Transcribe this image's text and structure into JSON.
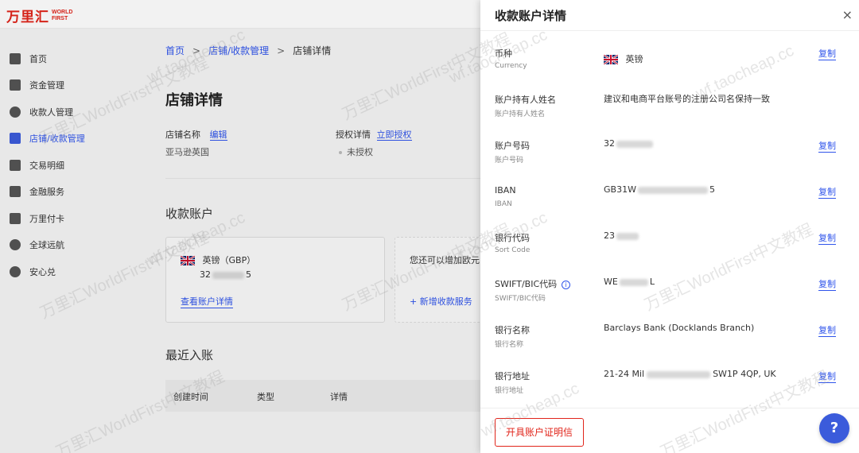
{
  "brand": {
    "cn": "万里汇",
    "en_line1": "WORLD",
    "en_line2": "FIRST"
  },
  "sidebar": {
    "items": [
      {
        "label": "首页",
        "icon": "home-icon"
      },
      {
        "label": "资金管理",
        "icon": "funds-icon"
      },
      {
        "label": "收款人管理",
        "icon": "payee-icon"
      },
      {
        "label": "店铺/收款管理",
        "icon": "store-icon",
        "active": true
      },
      {
        "label": "交易明细",
        "icon": "transactions-icon"
      },
      {
        "label": "金融服务",
        "icon": "finance-icon"
      },
      {
        "label": "万里付卡",
        "icon": "card-icon"
      },
      {
        "label": "全球远航",
        "icon": "global-icon"
      },
      {
        "label": "安心兑",
        "icon": "exchange-icon"
      }
    ]
  },
  "breadcrumb": {
    "home": "首页",
    "store": "店铺/收款管理",
    "current": "店铺详情",
    "sep": ">"
  },
  "main": {
    "title": "店铺详情",
    "store_name_label": "店铺名称",
    "store_name_edit": "编辑",
    "store_name_value": "亚马逊英国",
    "auth_label": "授权详情",
    "auth_link": "立即授权",
    "auth_value": "未授权",
    "accounts_title": "收款账户",
    "card1": {
      "currency": "英镑（GBP）",
      "account_prefix": "32",
      "account_suffix": "5",
      "link": "查看账户详情"
    },
    "card2": {
      "text": "您还可以增加欧元",
      "link": "+ 新增收款服务"
    },
    "recent_title": "最近入账",
    "table_headers": [
      "创建时间",
      "类型",
      "详情"
    ]
  },
  "drawer": {
    "title": "收款账户详情",
    "close": "×",
    "copy_label": "复制",
    "rows": [
      {
        "label": "币种",
        "sub": "Currency",
        "value": "英镑",
        "copy": true,
        "flag": true
      },
      {
        "label": "账户持有人姓名",
        "sub": "账户持有人姓名",
        "value": "建议和电商平台账号的注册公司名保持一致",
        "copy": false
      },
      {
        "label": "账户号码",
        "sub": "账户号码",
        "value": "32",
        "copy": true
      },
      {
        "label": "IBAN",
        "sub": "IBAN",
        "value": "GB31W",
        "value_suffix": "5",
        "copy": true
      },
      {
        "label": "银行代码",
        "sub": "Sort Code",
        "value": "23",
        "copy": true
      },
      {
        "label": "SWIFT/BIC代码",
        "sub": "SWIFT/BIC代码",
        "value": "WE",
        "value_suffix": "L",
        "copy": true,
        "info": true
      },
      {
        "label": "银行名称",
        "sub": "银行名称",
        "value": "Barclays Bank (Docklands Branch)",
        "copy": true
      },
      {
        "label": "银行地址",
        "sub": "银行地址",
        "value": "21-24 Mil",
        "value_suffix": "SW1P 4QP, UK",
        "copy": true
      }
    ],
    "cert_button": "开具账户证明信"
  },
  "help_label": "?",
  "watermark": {
    "cn": "万里汇WorldFirst中文教程",
    "en": "wf.taocheap.cc"
  },
  "colors": {
    "brand_red": "#e1251b",
    "link_blue": "#2f54eb",
    "help_blue": "#3b5bdb"
  }
}
